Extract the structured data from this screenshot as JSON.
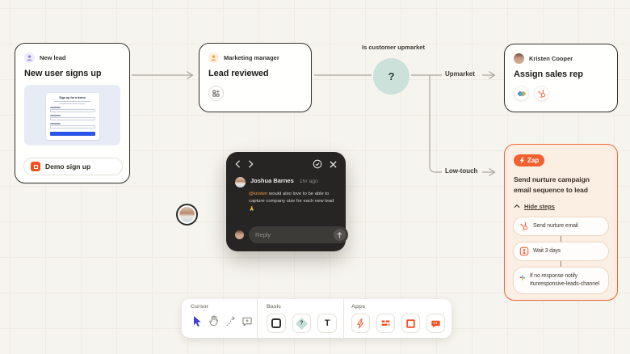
{
  "nodes": {
    "new_lead": {
      "role": "New lead",
      "title": "New user signs up",
      "form_preview": {
        "title": "Sign up for a demo"
      },
      "action_label": "Demo sign up"
    },
    "lead_reviewed": {
      "role": "Marketing manager",
      "title": "Lead reviewed"
    },
    "decision": {
      "question": "Is customer upmarket",
      "symbol": "?"
    },
    "branches": {
      "upmarket": "Upmarket",
      "low_touch": "Low-touch"
    },
    "assign_rep": {
      "role": "Kristen Cooper",
      "title": "Assign sales rep"
    },
    "zap": {
      "badge": "Zap",
      "title": "Send nurture campaign email sequence to lead",
      "toggle": "Hide steps",
      "steps": [
        {
          "icon": "hubspot-icon",
          "label": "Send nurture email"
        },
        {
          "icon": "delay-icon",
          "label": "Wait 3 days"
        },
        {
          "icon": "slack-icon",
          "label": "If no response notify #unresponsive-leads-channel"
        }
      ]
    }
  },
  "comment": {
    "author": "Joshua Barnes",
    "time": "1hr ago",
    "mention": "@kristen",
    "body": " would also love to be able to capture company size for each new lead 🙏",
    "reply_placeholder": "Reply"
  },
  "toolbar": {
    "sections": [
      {
        "label": "Cursor"
      },
      {
        "label": "Basic"
      },
      {
        "label": "Apps"
      }
    ],
    "decision_glyph": "?",
    "text_tool_glyph": "T"
  },
  "colors": {
    "canvas": "#F6F4EE",
    "accent_orange": "#F4501F",
    "zap_border": "#F2683A",
    "zap_bg": "#FBEEE2",
    "decision_teal": "#CBE1DA",
    "select_blue": "#3F3BD8",
    "popup_bg": "#262523",
    "mention_orange": "#E89A3C"
  }
}
